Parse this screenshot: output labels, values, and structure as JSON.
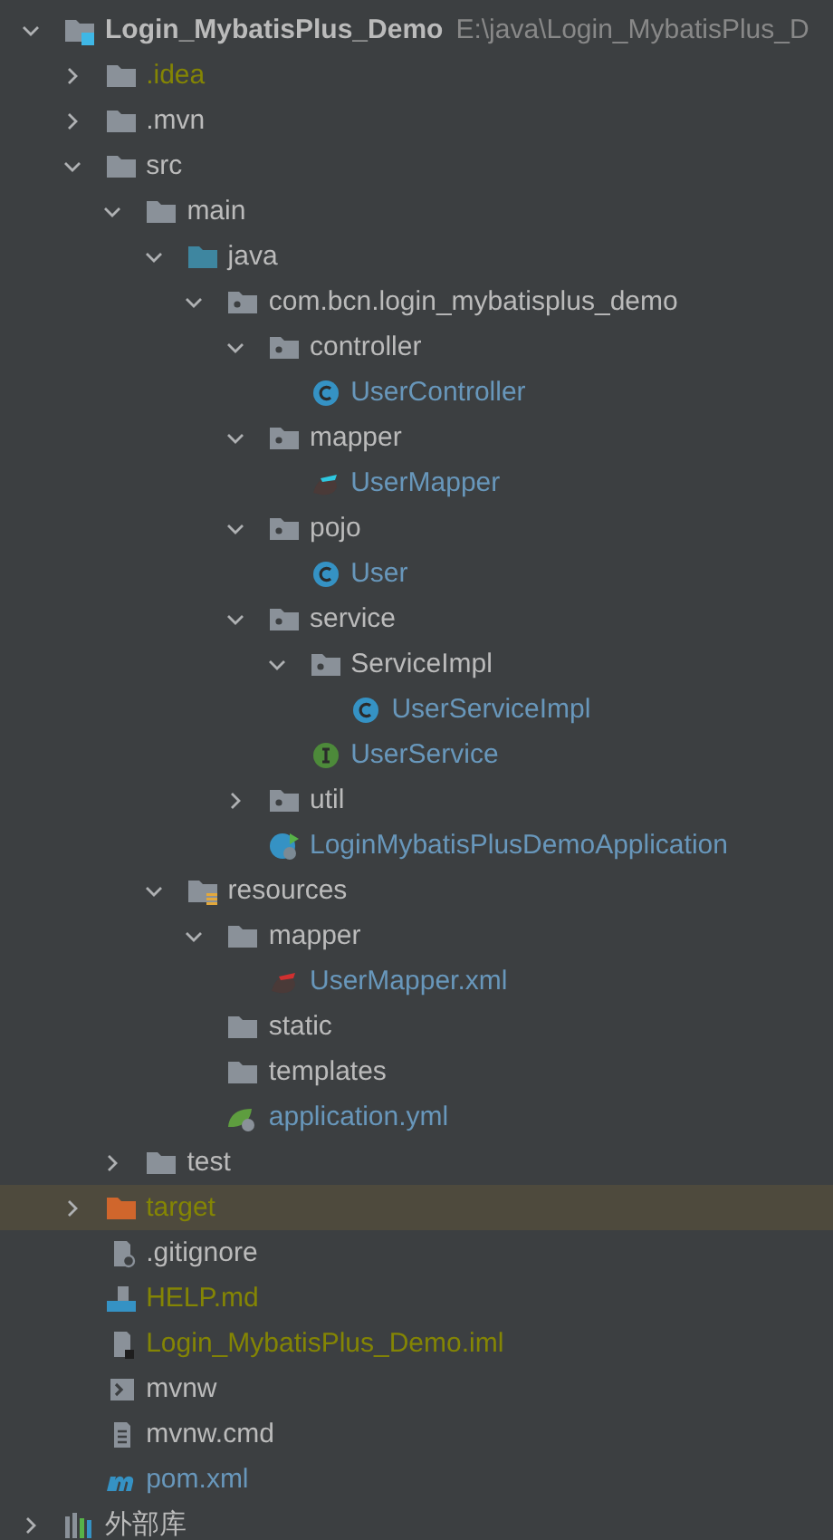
{
  "tree": [
    {
      "name": "Login_MybatisPlus_Demo",
      "path": "E:\\java\\Login_MybatisPlus_D",
      "kind": "module",
      "color": "#bbbbbb",
      "expanded": true,
      "selected": false,
      "children": [
        {
          "name": ".idea",
          "kind": "folder",
          "color": "#848504",
          "expanded": false,
          "selected": false
        },
        {
          "name": ".mvn",
          "kind": "folder",
          "color": "#bbbbbb",
          "expanded": false,
          "selected": false
        },
        {
          "name": "src",
          "kind": "folder",
          "color": "#bbbbbb",
          "expanded": true,
          "selected": false,
          "children": [
            {
              "name": "main",
              "kind": "folder",
              "color": "#bbbbbb",
              "expanded": true,
              "selected": false,
              "children": [
                {
                  "name": "java",
                  "kind": "source-folder",
                  "color": "#bbbbbb",
                  "expanded": true,
                  "selected": false,
                  "children": [
                    {
                      "name": "com.bcn.login_mybatisplus_demo",
                      "kind": "package",
                      "color": "#bbbbbb",
                      "expanded": true,
                      "selected": false,
                      "children": [
                        {
                          "name": "controller",
                          "kind": "package",
                          "color": "#bbbbbb",
                          "expanded": true,
                          "selected": false,
                          "children": [
                            {
                              "name": "UserController",
                              "kind": "class",
                              "color": "#6897bb",
                              "selected": false
                            }
                          ]
                        },
                        {
                          "name": "mapper",
                          "kind": "package",
                          "color": "#bbbbbb",
                          "expanded": true,
                          "selected": false,
                          "children": [
                            {
                              "name": "UserMapper",
                              "kind": "mybatis",
                              "color": "#6897bb",
                              "selected": false
                            }
                          ]
                        },
                        {
                          "name": "pojo",
                          "kind": "package",
                          "color": "#bbbbbb",
                          "expanded": true,
                          "selected": false,
                          "children": [
                            {
                              "name": "User",
                              "kind": "class",
                              "color": "#6897bb",
                              "selected": false
                            }
                          ]
                        },
                        {
                          "name": "service",
                          "kind": "package",
                          "color": "#bbbbbb",
                          "expanded": true,
                          "selected": false,
                          "children": [
                            {
                              "name": "ServiceImpl",
                              "kind": "package",
                              "color": "#bbbbbb",
                              "expanded": true,
                              "selected": false,
                              "children": [
                                {
                                  "name": "UserServiceImpl",
                                  "kind": "class",
                                  "color": "#6897bb",
                                  "selected": false
                                }
                              ]
                            },
                            {
                              "name": "UserService",
                              "kind": "interface",
                              "color": "#6897bb",
                              "selected": false
                            }
                          ]
                        },
                        {
                          "name": "util",
                          "kind": "package",
                          "color": "#bbbbbb",
                          "expanded": false,
                          "selected": false
                        },
                        {
                          "name": "LoginMybatisPlusDemoApplication",
                          "kind": "spring-app",
                          "color": "#6897bb",
                          "selected": false
                        }
                      ]
                    }
                  ]
                },
                {
                  "name": "resources",
                  "kind": "resources-folder",
                  "color": "#bbbbbb",
                  "expanded": true,
                  "selected": false,
                  "children": [
                    {
                      "name": "mapper",
                      "kind": "folder",
                      "color": "#bbbbbb",
                      "expanded": true,
                      "selected": false,
                      "children": [
                        {
                          "name": "UserMapper.xml",
                          "kind": "mybatis-xml",
                          "color": "#6897bb",
                          "selected": false
                        }
                      ]
                    },
                    {
                      "name": "static",
                      "kind": "folder",
                      "color": "#bbbbbb",
                      "selected": false
                    },
                    {
                      "name": "templates",
                      "kind": "folder",
                      "color": "#bbbbbb",
                      "selected": false
                    },
                    {
                      "name": "application.yml",
                      "kind": "spring-config",
                      "color": "#6897bb",
                      "selected": false
                    }
                  ]
                }
              ]
            },
            {
              "name": "test",
              "kind": "folder",
              "color": "#bbbbbb",
              "expanded": false,
              "selected": false
            }
          ]
        },
        {
          "name": "target",
          "kind": "excluded-folder",
          "color": "#848504",
          "expanded": false,
          "selected": true
        },
        {
          "name": ".gitignore",
          "kind": "gitignore",
          "color": "#bbbbbb",
          "selected": false
        },
        {
          "name": "HELP.md",
          "kind": "markdown",
          "color": "#848504",
          "selected": false
        },
        {
          "name": "Login_MybatisPlus_Demo.iml",
          "kind": "iml",
          "color": "#848504",
          "selected": false
        },
        {
          "name": "mvnw",
          "kind": "shell",
          "color": "#bbbbbb",
          "selected": false
        },
        {
          "name": "mvnw.cmd",
          "kind": "text-file",
          "color": "#bbbbbb",
          "selected": false
        },
        {
          "name": "pom.xml",
          "kind": "maven",
          "color": "#6897bb",
          "selected": false
        }
      ]
    },
    {
      "name": "外部库",
      "kind": "library",
      "color": "#bbbbbb",
      "expanded": false,
      "selected": false
    }
  ]
}
